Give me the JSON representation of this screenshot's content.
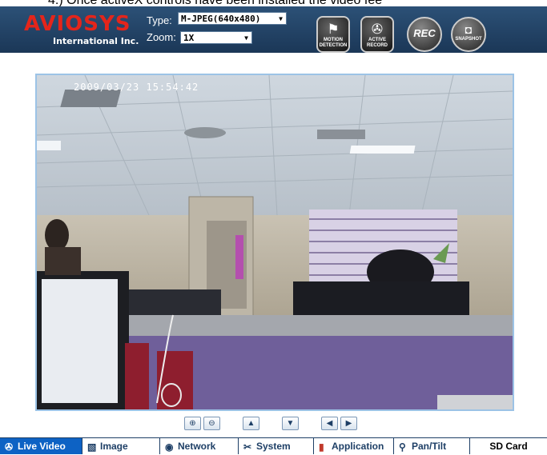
{
  "doc_caption": "4.) Once activeX controls have been installed the video fee",
  "brand": {
    "name": "AVIOSYS",
    "subtitle": "International Inc."
  },
  "controls": {
    "type_label": "Type:",
    "type_value": "M-JPEG(640x480)",
    "zoom_label": "Zoom:",
    "zoom_value": "1X"
  },
  "header_buttons": [
    {
      "label": "MOTION DETECTION",
      "icon": "running-people-icon"
    },
    {
      "label": "ACTIVE RECORD",
      "icon": "camera-icon"
    },
    {
      "label": "REC",
      "icon": "record-camera-icon"
    },
    {
      "label": "SNAPSHOT",
      "icon": "camera-icon"
    }
  ],
  "video": {
    "timestamp": "2009/03/23 15:54:42"
  },
  "ptz_buttons": [
    {
      "name": "zoom-in",
      "glyph": "⊕"
    },
    {
      "name": "zoom-out",
      "glyph": "⊖"
    },
    {
      "name": "up",
      "glyph": "▲"
    },
    {
      "name": "down",
      "glyph": "▼"
    },
    {
      "name": "left",
      "glyph": "◀"
    },
    {
      "name": "right",
      "glyph": "▶"
    }
  ],
  "tabs": [
    {
      "label": "Live Video",
      "icon": "camera-icon",
      "active": true
    },
    {
      "label": "Image",
      "icon": "image-icon",
      "active": false
    },
    {
      "label": "Network",
      "icon": "globe-icon",
      "active": false
    },
    {
      "label": "System",
      "icon": "tools-icon",
      "active": false
    },
    {
      "label": "Application",
      "icon": "book-icon",
      "active": false
    },
    {
      "label": "Pan/Tilt",
      "icon": "magnifier-icon",
      "active": false
    },
    {
      "label": "SD Card",
      "icon": "",
      "active": false
    }
  ],
  "colors": {
    "header": "#1e3f66",
    "brand_red": "#e4251b",
    "active_tab": "#0d62c4",
    "frame": "#9cc3e6"
  }
}
